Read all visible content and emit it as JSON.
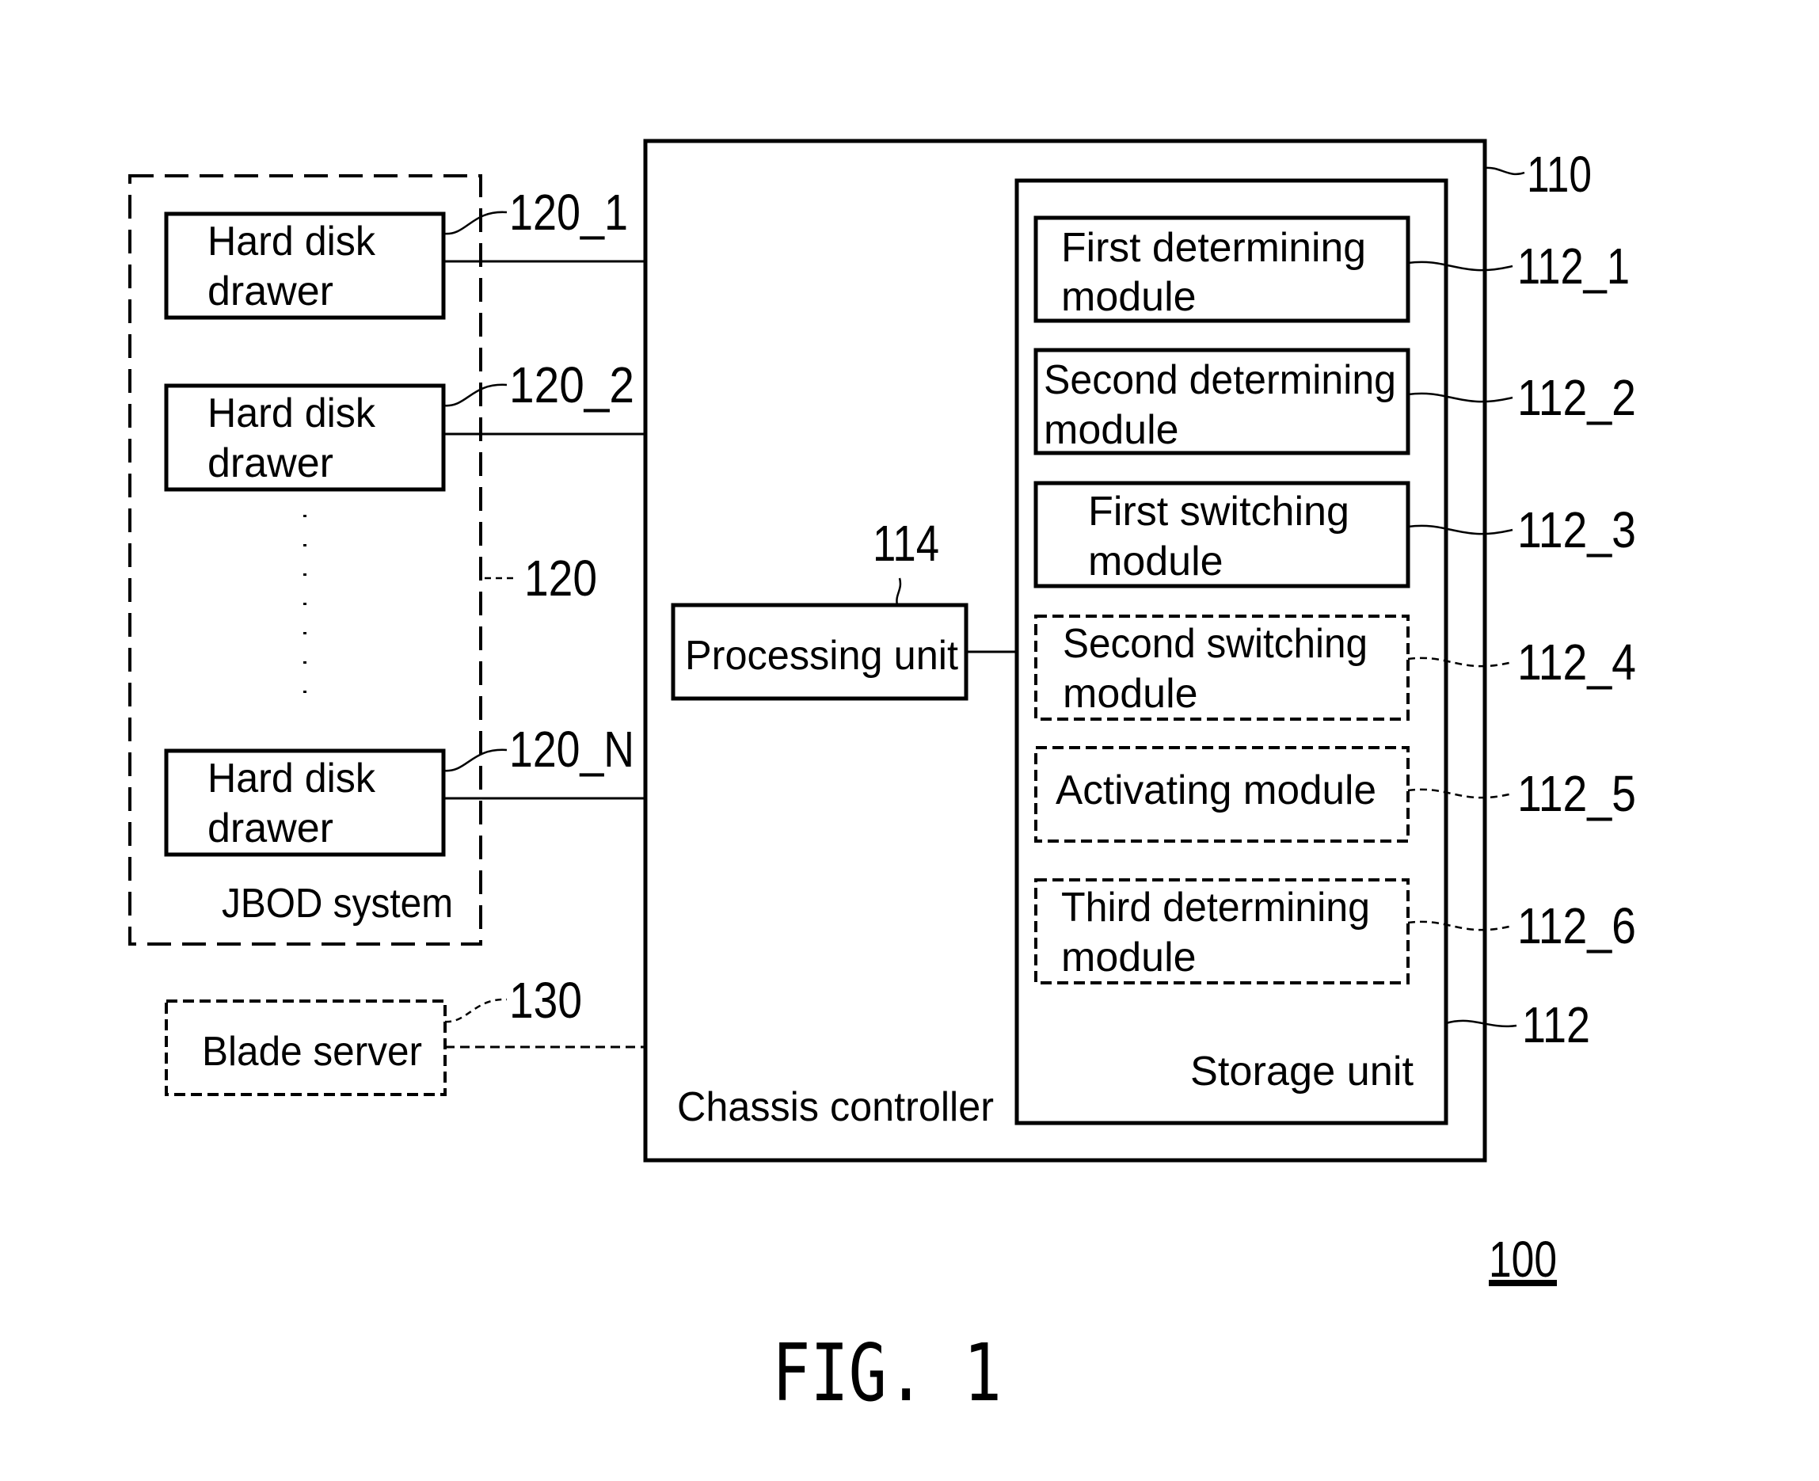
{
  "figure": {
    "title": "FIG. 1",
    "system_ref": "100"
  },
  "jbod": {
    "label": "JBOD system",
    "ref": "120",
    "drawers": [
      {
        "line1": "Hard disk",
        "line2": "drawer",
        "ref": "120_1"
      },
      {
        "line1": "Hard disk",
        "line2": "drawer",
        "ref": "120_2"
      },
      {
        "line1": "Hard disk",
        "line2": "drawer",
        "ref": "120_N"
      }
    ]
  },
  "blade_server": {
    "label": "Blade server",
    "ref": "130"
  },
  "chassis_controller": {
    "label": "Chassis controller",
    "ref": "110",
    "processing_unit": {
      "label": "Processing unit",
      "ref": "114"
    },
    "storage_unit": {
      "label": "Storage unit",
      "ref": "112",
      "modules": [
        {
          "line1": "First determining",
          "line2": "module",
          "ref": "112_1",
          "optional": false
        },
        {
          "line1": "Second determining",
          "line2": "module",
          "ref": "112_2",
          "optional": false
        },
        {
          "line1": "First switching",
          "line2": "module",
          "ref": "112_3",
          "optional": false
        },
        {
          "line1": "Second switching",
          "line2": "module",
          "ref": "112_4",
          "optional": true
        },
        {
          "line1": "Activating module",
          "line2": "",
          "ref": "112_5",
          "optional": true
        },
        {
          "line1": "Third determining",
          "line2": "module",
          "ref": "112_6",
          "optional": true
        }
      ]
    }
  }
}
